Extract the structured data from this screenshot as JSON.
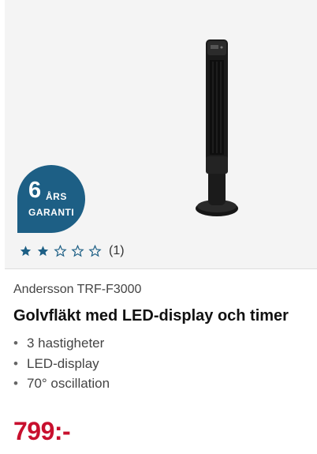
{
  "product": {
    "badge": {
      "number": "6",
      "years": "ÅRS",
      "guarantee": "GARANTI"
    },
    "rating": {
      "stars_filled": 2,
      "stars_total": 5,
      "count": "(1)"
    },
    "brand": "Andersson TRF-F3000",
    "title": "Golvfläkt med LED-display och timer",
    "features": [
      "3 hastigheter",
      "LED-display",
      "70° oscillation"
    ],
    "price": "799:-"
  },
  "colors": {
    "badge": "#1d5f85",
    "star": "#1d5f85",
    "price": "#c8102e"
  }
}
